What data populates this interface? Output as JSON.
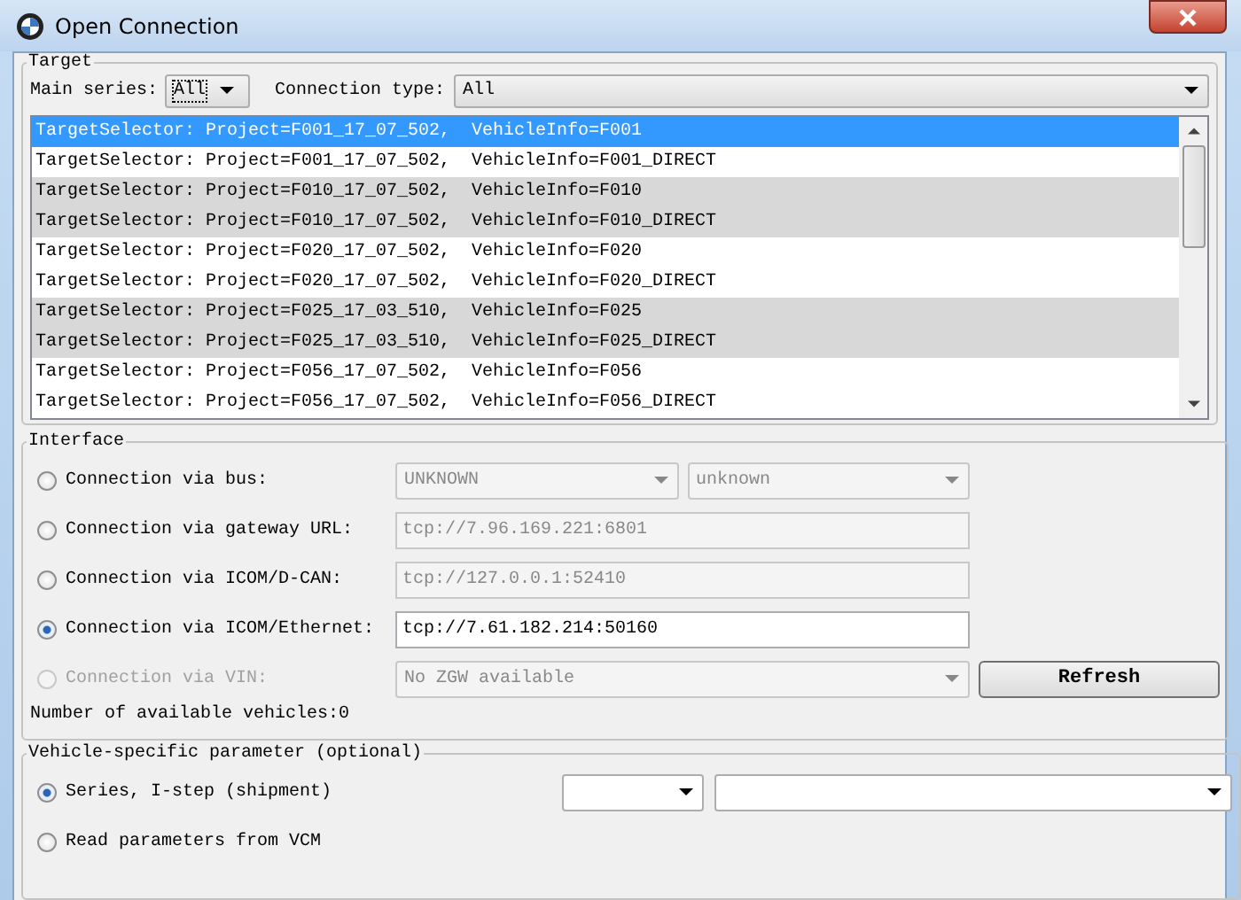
{
  "window": {
    "title": "Open Connection"
  },
  "target": {
    "title": "Target",
    "main_series_label": "Main series:",
    "main_series": "All",
    "connection_type_label": "Connection type:",
    "connection_type": "All",
    "rows": [
      {
        "text": "TargetSelector: Project=F001_17_07_502,  VehicleInfo=F001",
        "selected": true,
        "shaded": false
      },
      {
        "text": "TargetSelector: Project=F001_17_07_502,  VehicleInfo=F001_DIRECT",
        "selected": false,
        "shaded": false
      },
      {
        "text": "TargetSelector: Project=F010_17_07_502,  VehicleInfo=F010",
        "selected": false,
        "shaded": true
      },
      {
        "text": "TargetSelector: Project=F010_17_07_502,  VehicleInfo=F010_DIRECT",
        "selected": false,
        "shaded": true
      },
      {
        "text": "TargetSelector: Project=F020_17_07_502,  VehicleInfo=F020",
        "selected": false,
        "shaded": false
      },
      {
        "text": "TargetSelector: Project=F020_17_07_502,  VehicleInfo=F020_DIRECT",
        "selected": false,
        "shaded": false
      },
      {
        "text": "TargetSelector: Project=F025_17_03_510,  VehicleInfo=F025",
        "selected": false,
        "shaded": true
      },
      {
        "text": "TargetSelector: Project=F025_17_03_510,  VehicleInfo=F025_DIRECT",
        "selected": false,
        "shaded": true
      },
      {
        "text": "TargetSelector: Project=F056_17_07_502,  VehicleInfo=F056",
        "selected": false,
        "shaded": false
      },
      {
        "text": "TargetSelector: Project=F056_17_07_502,  VehicleInfo=F056_DIRECT",
        "selected": false,
        "shaded": false
      }
    ]
  },
  "interface": {
    "title": "Interface",
    "options": [
      {
        "label": "Connection via bus:",
        "selected": false,
        "disabled": false,
        "fields": [
          {
            "kind": "dropdown",
            "value": "UNKNOWN",
            "disabled": true
          },
          {
            "kind": "dropdown",
            "value": "unknown",
            "disabled": true
          }
        ]
      },
      {
        "label": "Connection via gateway URL:",
        "selected": false,
        "disabled": false,
        "fields": [
          {
            "kind": "text",
            "value": "tcp://7.96.169.221:6801",
            "disabled": true
          }
        ]
      },
      {
        "label": "Connection via ICOM/D-CAN:",
        "selected": false,
        "disabled": false,
        "fields": [
          {
            "kind": "text",
            "value": "tcp://127.0.0.1:52410",
            "disabled": true
          }
        ]
      },
      {
        "label": "Connection via ICOM/Ethernet:",
        "selected": true,
        "disabled": false,
        "fields": [
          {
            "kind": "text",
            "value": "tcp://7.61.182.214:50160",
            "disabled": false
          }
        ]
      },
      {
        "label": "Connection via VIN:",
        "selected": false,
        "disabled": true,
        "fields": [
          {
            "kind": "dropdown",
            "value": "No ZGW available",
            "disabled": true
          }
        ],
        "button": {
          "label": "Refresh",
          "disabled": false
        }
      }
    ],
    "vehicle_count": "Number of available vehicles:0"
  },
  "vehicle": {
    "title": "Vehicle-specific parameter (optional)",
    "options": [
      {
        "label": "Series, I-step (shipment)",
        "selected": true,
        "fields": [
          {
            "kind": "dropdown"
          },
          {
            "kind": "dropdown"
          }
        ]
      },
      {
        "label": "Read parameters from VCM",
        "selected": false
      }
    ]
  }
}
